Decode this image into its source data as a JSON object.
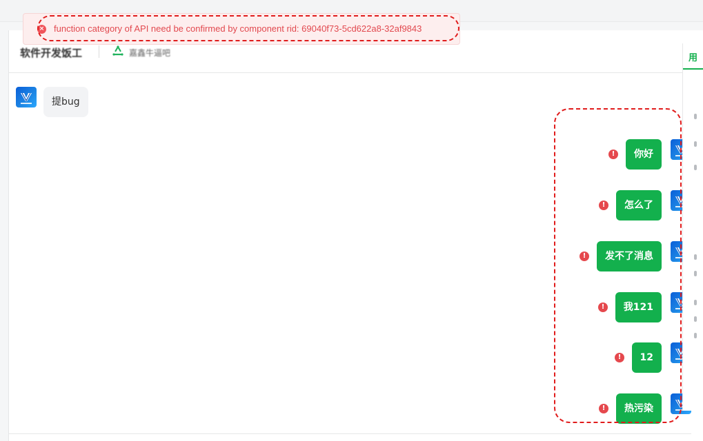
{
  "header": {
    "title": "软件开发饭工",
    "subtitle": "嘉鑫牛逼吧"
  },
  "toast": {
    "message": "function category of API need be confirmed by component rid: 69040f73-5cd622a8-32af9843"
  },
  "chat": {
    "incoming": [
      {
        "text": "提bug"
      }
    ],
    "outgoing": [
      {
        "text": "你好",
        "status": "error"
      },
      {
        "text": "怎么了",
        "status": "error"
      },
      {
        "text": "发不了消息",
        "status": "error"
      },
      {
        "text": "我121",
        "status": "error"
      },
      {
        "text": "12",
        "status": "error"
      },
      {
        "text": "热污染",
        "status": "error"
      }
    ]
  },
  "right_panel": {
    "tab_label": "用"
  },
  "icons": {
    "error": "exclamation-circle-icon",
    "toast_close": "close-circle-icon",
    "header_logo": "recycle-icon",
    "avatar": "app-logo-avatar"
  },
  "colors": {
    "accent": "#13b04d",
    "error": "#e5484d",
    "toast_text": "#e2494f",
    "toast_bg": "#fdeeee"
  }
}
